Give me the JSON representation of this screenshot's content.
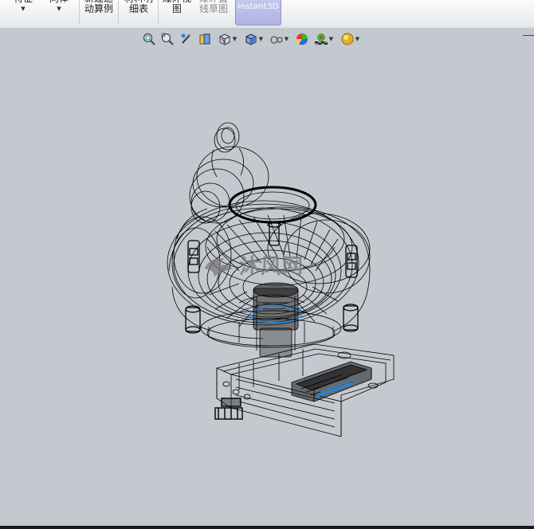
{
  "ribbon": {
    "buttons": [
      {
        "label": "特征",
        "has_dropdown": true
      },
      {
        "label": "向体",
        "has_dropdown": true
      },
      {
        "label": "新建运\n动算例",
        "has_dropdown": false
      },
      {
        "label": "材料明\n细表",
        "has_dropdown": false
      },
      {
        "label": "爆炸视\n图",
        "has_dropdown": false
      },
      {
        "label": "爆炸直\n线草图",
        "has_dropdown": false,
        "disabled": true
      },
      {
        "label": "Instant3D",
        "active": true
      }
    ]
  },
  "view_toolbar": {
    "icons": [
      "zoom-to-fit-icon",
      "zoom-to-area-icon",
      "previous-view-icon",
      "section-view-icon",
      "view-orientation-icon",
      "display-style-icon",
      "hide-show-items-icon",
      "edit-appearance-icon",
      "apply-scene-icon",
      "view-settings-icon"
    ]
  },
  "watermark": {
    "text": "沐风网"
  },
  "colors": {
    "background": "#c4c8cf",
    "wire": "#000000",
    "highlight": "#1e88e5"
  }
}
